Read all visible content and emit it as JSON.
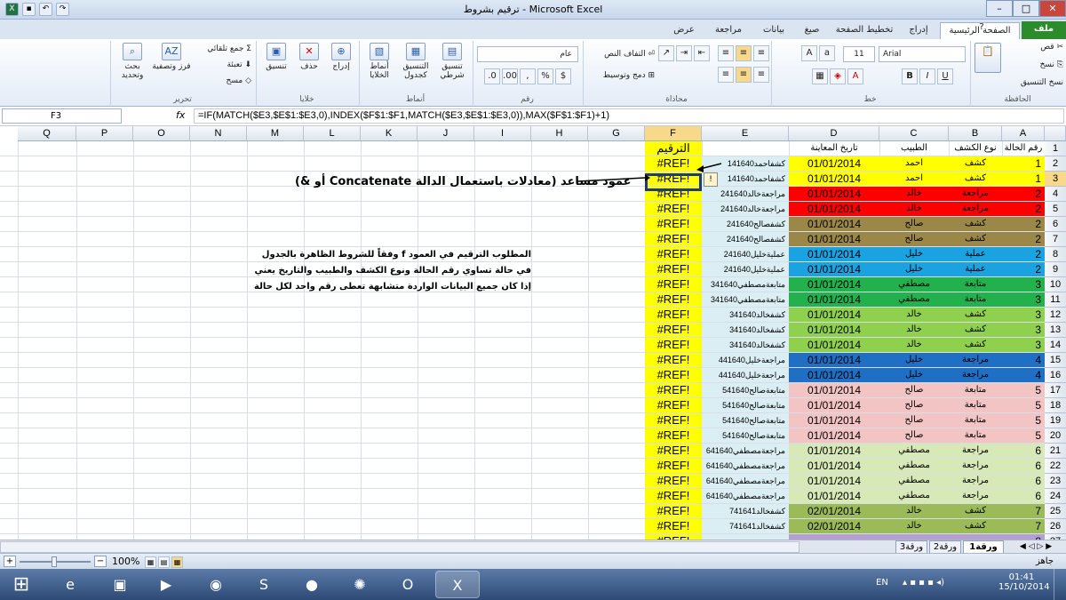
{
  "window": {
    "title": "ترقيم بشروط - Microsoft Excel",
    "min": "–",
    "max": "□",
    "close": "✕"
  },
  "ribbon_tabs": [
    "ملف",
    "الصفحة الرئيسية",
    "إدراج",
    "تخطيط الصفحة",
    "صيغ",
    "بيانات",
    "مراجعة",
    "عرض"
  ],
  "ribbon": {
    "clipboard": {
      "label": "الحافظة",
      "cut": "قص",
      "copy": "نسخ",
      "paste_format": "نسخ التنسيق"
    },
    "font": {
      "label": "خط",
      "name": "Arial",
      "size": "11"
    },
    "alignment": {
      "label": "محاذاة",
      "wrap": "التفاف النص",
      "merge": "دمج وتوسيط"
    },
    "number": {
      "label": "رقم",
      "format": "عام"
    },
    "styles": {
      "label": "أنماط",
      "cond": "تنسيق شرطي",
      "table": "التنسيق كجدول",
      "cell": "أنماط الخلايا"
    },
    "cells": {
      "label": "خلايا",
      "insert": "إدراج",
      "delete": "حذف",
      "format": "تنسيق"
    },
    "editing": {
      "label": "تحرير",
      "autosum": "جمع تلقائي",
      "fill": "تعبئة",
      "clear": "مسح",
      "sort": "فرز وتصفية",
      "find": "بحث وتحديد"
    }
  },
  "formula_bar": {
    "name_box": "F3",
    "fx": "fx",
    "formula": "=IF(MATCH($E3,$E$1:$E3,0),INDEX($F$1:$F1,MATCH($E3,$E$1:$E3,0)),MAX($F$1:$F1)+1)"
  },
  "columns": [
    "A",
    "B",
    "C",
    "D",
    "E",
    "F",
    "G",
    "H",
    "I",
    "J",
    "K",
    "L",
    "M",
    "N",
    "O",
    "P",
    "Q"
  ],
  "headers": {
    "A": "رقم الحالة",
    "B": "نوع الكشف",
    "C": "الطبيب",
    "D": "تاريخ المعاينة",
    "F": "الترقيم"
  },
  "rows": [
    {
      "n": "2",
      "a": "1",
      "b": "كشف",
      "c": "احمد",
      "d": "01/01/2014",
      "e": "1كشفاحمد41640",
      "f": "#REF!",
      "bg": "#ffff00"
    },
    {
      "n": "3",
      "a": "1",
      "b": "كشف",
      "c": "احمد",
      "d": "01/01/2014",
      "e": "1كشفاحمد41640",
      "f": "#REF!",
      "bg": "#ffff00"
    },
    {
      "n": "4",
      "a": "2",
      "b": "مراجعة",
      "c": "خالد",
      "d": "01/01/2014",
      "e": "2مراجعةخالد41640",
      "f": "#REF!",
      "bg": "#ff0000"
    },
    {
      "n": "5",
      "a": "2",
      "b": "مراجعة",
      "c": "خالد",
      "d": "01/01/2014",
      "e": "2مراجعةخالد41640",
      "f": "#REF!",
      "bg": "#ff0000"
    },
    {
      "n": "6",
      "a": "2",
      "b": "كشف",
      "c": "صالح",
      "d": "01/01/2014",
      "e": "2كشفصالح41640",
      "f": "#REF!",
      "bg": "#9b8848"
    },
    {
      "n": "7",
      "a": "2",
      "b": "كشف",
      "c": "صالح",
      "d": "01/01/2014",
      "e": "2كشفصالح41640",
      "f": "#REF!",
      "bg": "#9b8848"
    },
    {
      "n": "8",
      "a": "2",
      "b": "عملية",
      "c": "خليل",
      "d": "01/01/2014",
      "e": "2عمليةخليل41640",
      "f": "#REF!",
      "bg": "#1aa3e0"
    },
    {
      "n": "9",
      "a": "2",
      "b": "عملية",
      "c": "خليل",
      "d": "01/01/2014",
      "e": "2عمليةخليل41640",
      "f": "#REF!",
      "bg": "#1aa3e0"
    },
    {
      "n": "10",
      "a": "3",
      "b": "متابعة",
      "c": "مصطفي",
      "d": "01/01/2014",
      "e": "3متابعةمصطفي41640",
      "f": "#REF!",
      "bg": "#22b14c"
    },
    {
      "n": "11",
      "a": "3",
      "b": "متابعة",
      "c": "مصطفي",
      "d": "01/01/2014",
      "e": "3متابعةمصطفي41640",
      "f": "#REF!",
      "bg": "#22b14c"
    },
    {
      "n": "12",
      "a": "3",
      "b": "كشف",
      "c": "خالد",
      "d": "01/01/2014",
      "e": "3كشفخالد41640",
      "f": "#REF!",
      "bg": "#8fd14f"
    },
    {
      "n": "13",
      "a": "3",
      "b": "كشف",
      "c": "خالد",
      "d": "01/01/2014",
      "e": "3كشفخالد41640",
      "f": "#REF!",
      "bg": "#8fd14f"
    },
    {
      "n": "14",
      "a": "3",
      "b": "كشف",
      "c": "خالد",
      "d": "01/01/2014",
      "e": "3كشفخالد41640",
      "f": "#REF!",
      "bg": "#8fd14f"
    },
    {
      "n": "15",
      "a": "4",
      "b": "مراجعة",
      "c": "خليل",
      "d": "01/01/2014",
      "e": "4مراجعةخليل41640",
      "f": "#REF!",
      "bg": "#1f6fc4"
    },
    {
      "n": "16",
      "a": "4",
      "b": "مراجعة",
      "c": "خليل",
      "d": "01/01/2014",
      "e": "4مراجعةخليل41640",
      "f": "#REF!",
      "bg": "#1f6fc4"
    },
    {
      "n": "17",
      "a": "5",
      "b": "متابعة",
      "c": "صالح",
      "d": "01/01/2014",
      "e": "5متابعةصالح41640",
      "f": "#REF!",
      "bg": "#f2c4c4"
    },
    {
      "n": "18",
      "a": "5",
      "b": "متابعة",
      "c": "صالح",
      "d": "01/01/2014",
      "e": "5متابعةصالح41640",
      "f": "#REF!",
      "bg": "#f2c4c4"
    },
    {
      "n": "19",
      "a": "5",
      "b": "متابعة",
      "c": "صالح",
      "d": "01/01/2014",
      "e": "5متابعةصالح41640",
      "f": "#REF!",
      "bg": "#f2c4c4"
    },
    {
      "n": "20",
      "a": "5",
      "b": "متابعة",
      "c": "صالح",
      "d": "01/01/2014",
      "e": "5متابعةصالح41640",
      "f": "#REF!",
      "bg": "#f2c4c4"
    },
    {
      "n": "21",
      "a": "6",
      "b": "مراجعة",
      "c": "مصطفي",
      "d": "01/01/2014",
      "e": "6مراجعةمصطفي41640",
      "f": "#REF!",
      "bg": "#d8e9b8"
    },
    {
      "n": "22",
      "a": "6",
      "b": "مراجعة",
      "c": "مصطفي",
      "d": "01/01/2014",
      "e": "6مراجعةمصطفي41640",
      "f": "#REF!",
      "bg": "#d8e9b8"
    },
    {
      "n": "23",
      "a": "6",
      "b": "مراجعة",
      "c": "مصطفي",
      "d": "01/01/2014",
      "e": "6مراجعةمصطفي41640",
      "f": "#REF!",
      "bg": "#d8e9b8"
    },
    {
      "n": "24",
      "a": "6",
      "b": "مراجعة",
      "c": "مصطفي",
      "d": "01/01/2014",
      "e": "6مراجعةمصطفي41640",
      "f": "#REF!",
      "bg": "#d8e9b8"
    },
    {
      "n": "25",
      "a": "7",
      "b": "كشف",
      "c": "خالد",
      "d": "02/01/2014",
      "e": "7كشفخالد41641",
      "f": "#REF!",
      "bg": "#9bbb59"
    },
    {
      "n": "26",
      "a": "7",
      "b": "كشف",
      "c": "خالد",
      "d": "02/01/2014",
      "e": "7كشفخالد41641",
      "f": "#REF!",
      "bg": "#9bbb59"
    },
    {
      "n": "27",
      "a": "8",
      "b": "",
      "c": "",
      "d": "",
      "e": "",
      "f": "#REF!",
      "bg": "#b4a0d0"
    }
  ],
  "notes": {
    "helper": "عمود مساعد (معادلات باستعمال الدالة Concatenate أو &)",
    "task": "المطلوب الترقيم في العمود f وفقاً للشروط الظاهرة بالجدول في حالة تساوي رقم الحالة ونوع الكشف والطبيب والتاريخ يعني إذا كان جميع البيانات الواردة متشابهة تعطى رقم واحد لكل حالة"
  },
  "sheets": [
    "ورقة1",
    "ورقة2",
    "ورقة3"
  ],
  "status": {
    "ready": "جاهز",
    "zoom": "100%"
  },
  "taskbar": {
    "lang": "EN",
    "time": "01:41",
    "date": "15/10/2014"
  }
}
